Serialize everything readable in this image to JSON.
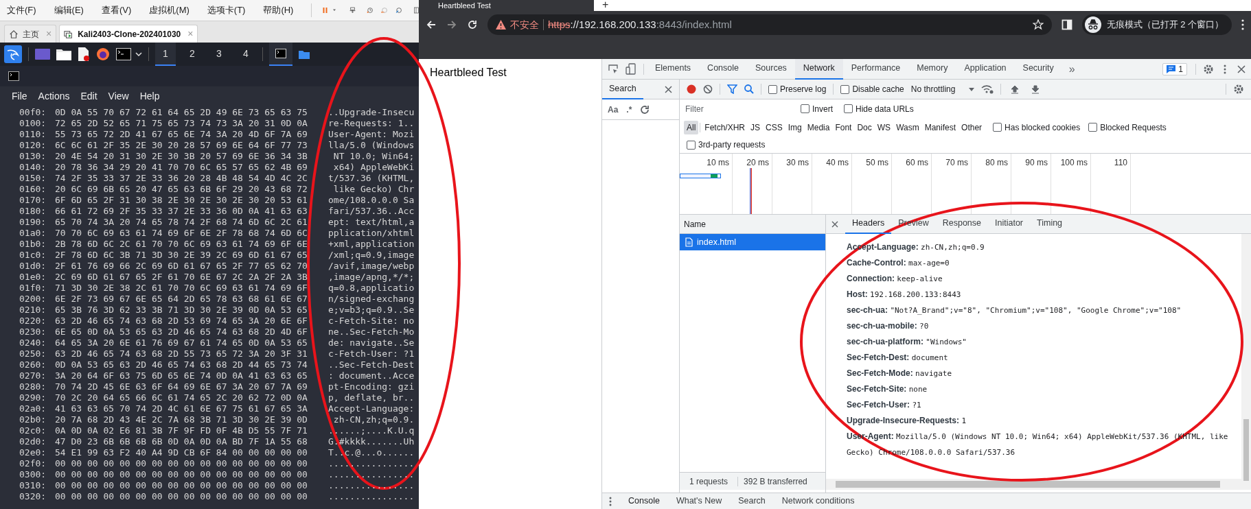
{
  "vm": {
    "menu": [
      "文件(F)",
      "编辑(E)",
      "查看(V)",
      "虚拟机(M)",
      "选项卡(T)",
      "帮助(H)"
    ],
    "tabs": [
      {
        "label": "主页",
        "selected": false,
        "close": "×"
      },
      {
        "label": "Kali2403-Clone-202401030",
        "selected": true,
        "close": "×"
      }
    ],
    "workspaces": [
      {
        "label": "1",
        "selected": true
      },
      {
        "label": "2",
        "selected": false
      },
      {
        "label": "3",
        "selected": false
      },
      {
        "label": "4",
        "selected": false
      }
    ],
    "terminal": {
      "menu": [
        "File",
        "Actions",
        "Edit",
        "View",
        "Help"
      ],
      "hex_lines": [
        {
          "offset": "00f0:",
          "bytes": "0D 0A 55 70 67 72 61 64 65 2D 49 6E 73 65 63 75",
          "ascii": "..Upgrade-Insecu"
        },
        {
          "offset": "0100:",
          "bytes": "72 65 2D 52 65 71 75 65 73 74 73 3A 20 31 0D 0A",
          "ascii": "re-Requests: 1.."
        },
        {
          "offset": "0110:",
          "bytes": "55 73 65 72 2D 41 67 65 6E 74 3A 20 4D 6F 7A 69",
          "ascii": "User-Agent: Mozi"
        },
        {
          "offset": "0120:",
          "bytes": "6C 6C 61 2F 35 2E 30 20 28 57 69 6E 64 6F 77 73",
          "ascii": "lla/5.0 (Windows"
        },
        {
          "offset": "0130:",
          "bytes": "20 4E 54 20 31 30 2E 30 3B 20 57 69 6E 36 34 3B",
          "ascii": " NT 10.0; Win64;"
        },
        {
          "offset": "0140:",
          "bytes": "20 78 36 34 29 20 41 70 70 6C 65 57 65 62 4B 69",
          "ascii": " x64) AppleWebKi"
        },
        {
          "offset": "0150:",
          "bytes": "74 2F 35 33 37 2E 33 36 20 28 4B 48 54 4D 4C 2C",
          "ascii": "t/537.36 (KHTML,"
        },
        {
          "offset": "0160:",
          "bytes": "20 6C 69 6B 65 20 47 65 63 6B 6F 29 20 43 68 72",
          "ascii": " like Gecko) Chr"
        },
        {
          "offset": "0170:",
          "bytes": "6F 6D 65 2F 31 30 38 2E 30 2E 30 2E 30 20 53 61",
          "ascii": "ome/108.0.0.0 Sa"
        },
        {
          "offset": "0180:",
          "bytes": "66 61 72 69 2F 35 33 37 2E 33 36 0D 0A 41 63 63",
          "ascii": "fari/537.36..Acc"
        },
        {
          "offset": "0190:",
          "bytes": "65 70 74 3A 20 74 65 78 74 2F 68 74 6D 6C 2C 61",
          "ascii": "ept: text/html,a"
        },
        {
          "offset": "01a0:",
          "bytes": "70 70 6C 69 63 61 74 69 6F 6E 2F 78 68 74 6D 6C",
          "ascii": "pplication/xhtml"
        },
        {
          "offset": "01b0:",
          "bytes": "2B 78 6D 6C 2C 61 70 70 6C 69 63 61 74 69 6F 6E",
          "ascii": "+xml,application"
        },
        {
          "offset": "01c0:",
          "bytes": "2F 78 6D 6C 3B 71 3D 30 2E 39 2C 69 6D 61 67 65",
          "ascii": "/xml;q=0.9,image"
        },
        {
          "offset": "01d0:",
          "bytes": "2F 61 76 69 66 2C 69 6D 61 67 65 2F 77 65 62 70",
          "ascii": "/avif,image/webp"
        },
        {
          "offset": "01e0:",
          "bytes": "2C 69 6D 61 67 65 2F 61 70 6E 67 2C 2A 2F 2A 3B",
          "ascii": ",image/apng,*/*;"
        },
        {
          "offset": "01f0:",
          "bytes": "71 3D 30 2E 38 2C 61 70 70 6C 69 63 61 74 69 6F",
          "ascii": "q=0.8,applicatio"
        },
        {
          "offset": "0200:",
          "bytes": "6E 2F 73 69 67 6E 65 64 2D 65 78 63 68 61 6E 67",
          "ascii": "n/signed-exchang"
        },
        {
          "offset": "0210:",
          "bytes": "65 3B 76 3D 62 33 3B 71 3D 30 2E 39 0D 0A 53 65",
          "ascii": "e;v=b3;q=0.9..Se"
        },
        {
          "offset": "0220:",
          "bytes": "63 2D 46 65 74 63 68 2D 53 69 74 65 3A 20 6E 6F",
          "ascii": "c-Fetch-Site: no"
        },
        {
          "offset": "0230:",
          "bytes": "6E 65 0D 0A 53 65 63 2D 46 65 74 63 68 2D 4D 6F",
          "ascii": "ne..Sec-Fetch-Mo"
        },
        {
          "offset": "0240:",
          "bytes": "64 65 3A 20 6E 61 76 69 67 61 74 65 0D 0A 53 65",
          "ascii": "de: navigate..Se"
        },
        {
          "offset": "0250:",
          "bytes": "63 2D 46 65 74 63 68 2D 55 73 65 72 3A 20 3F 31",
          "ascii": "c-Fetch-User: ?1"
        },
        {
          "offset": "0260:",
          "bytes": "0D 0A 53 65 63 2D 46 65 74 63 68 2D 44 65 73 74",
          "ascii": "..Sec-Fetch-Dest"
        },
        {
          "offset": "0270:",
          "bytes": "3A 20 64 6F 63 75 6D 65 6E 74 0D 0A 41 63 63 65",
          "ascii": ": document..Acce"
        },
        {
          "offset": "0280:",
          "bytes": "70 74 2D 45 6E 63 6F 64 69 6E 67 3A 20 67 7A 69",
          "ascii": "pt-Encoding: gzi"
        },
        {
          "offset": "0290:",
          "bytes": "70 2C 20 64 65 66 6C 61 74 65 2C 20 62 72 0D 0A",
          "ascii": "p, deflate, br.."
        },
        {
          "offset": "02a0:",
          "bytes": "41 63 63 65 70 74 2D 4C 61 6E 67 75 61 67 65 3A",
          "ascii": "Accept-Language:"
        },
        {
          "offset": "02b0:",
          "bytes": "20 7A 68 2D 43 4E 2C 7A 68 3B 71 3D 30 2E 39 0D",
          "ascii": " zh-CN,zh;q=0.9."
        },
        {
          "offset": "02c0:",
          "bytes": "0A 0D 0A 02 E6 81 3B 7F 9F FD 0F 4B D5 55 7F 71",
          "ascii": "......;....K.U.q"
        },
        {
          "offset": "02d0:",
          "bytes": "47 D0 23 6B 6B 6B 6B 0D 0A 0D 0A BD 7F 1A 55 68",
          "ascii": "G.#kkkk.......Uh"
        },
        {
          "offset": "02e0:",
          "bytes": "54 E1 99 63 F2 40 A4 9D CB 6F 84 00 00 00 00 00",
          "ascii": "T..c.@...o......"
        },
        {
          "offset": "02f0:",
          "bytes": "00 00 00 00 00 00 00 00 00 00 00 00 00 00 00 00",
          "ascii": "................"
        },
        {
          "offset": "0300:",
          "bytes": "00 00 00 00 00 00 00 00 00 00 00 00 00 00 00 00",
          "ascii": "................"
        },
        {
          "offset": "0310:",
          "bytes": "00 00 00 00 00 00 00 00 00 00 00 00 00 00 00 00",
          "ascii": "................"
        },
        {
          "offset": "0320:",
          "bytes": "00 00 00 00 00 00 00 00 00 00 00 00 00 00 00 00",
          "ascii": "................"
        }
      ]
    }
  },
  "browser": {
    "tab_title": "Heartbleed Test",
    "new_tab": "+",
    "security_label": "不安全",
    "url": {
      "scheme": "https",
      "host": "://192.168.200.133",
      "rest": ":8443/index.html"
    },
    "profile_label": "无痕模式（已打开 2 个窗口）",
    "page": {
      "heading": "Heartbleed Test"
    }
  },
  "devtools": {
    "tabs": [
      {
        "label": "Elements",
        "selected": false
      },
      {
        "label": "Console",
        "selected": false
      },
      {
        "label": "Sources",
        "selected": false
      },
      {
        "label": "Network",
        "selected": true
      },
      {
        "label": "Performance",
        "selected": false
      },
      {
        "label": "Memory",
        "selected": false
      },
      {
        "label": "Application",
        "selected": false
      },
      {
        "label": "Security",
        "selected": false
      }
    ],
    "more": "»",
    "issues_count": "1",
    "search_panel": {
      "tab": "Search",
      "options": [
        "Aa",
        ".*"
      ]
    },
    "network": {
      "toolbar_checkboxes": [
        {
          "label": "Preserve log",
          "checked": false
        },
        {
          "label": "Disable cache",
          "checked": false
        }
      ],
      "throttling": "No throttling",
      "filter_placeholder": "Filter",
      "filter_checkboxes": [
        {
          "label": "Invert",
          "checked": false
        },
        {
          "label": "Hide data URLs",
          "checked": false
        }
      ],
      "types": [
        {
          "label": "All",
          "selected": true
        },
        {
          "label": "Fetch/XHR",
          "selected": false
        },
        {
          "label": "JS",
          "selected": false
        },
        {
          "label": "CSS",
          "selected": false
        },
        {
          "label": "Img",
          "selected": false
        },
        {
          "label": "Media",
          "selected": false
        },
        {
          "label": "Font",
          "selected": false
        },
        {
          "label": "Doc",
          "selected": false
        },
        {
          "label": "WS",
          "selected": false
        },
        {
          "label": "Wasm",
          "selected": false
        },
        {
          "label": "Manifest",
          "selected": false
        },
        {
          "label": "Other",
          "selected": false
        }
      ],
      "type_checkboxes": [
        {
          "label": "Has blocked cookies",
          "checked": false
        },
        {
          "label": "Blocked Requests",
          "checked": false
        }
      ],
      "extra_checkboxes": [
        {
          "label": "3rd-party requests",
          "checked": false
        }
      ],
      "timeline_ticks": [
        "10 ms",
        "20 ms",
        "30 ms",
        "40 ms",
        "50 ms",
        "60 ms",
        "70 ms",
        "80 ms",
        "90 ms",
        "100 ms",
        "110"
      ],
      "name_column": "Name",
      "requests": [
        {
          "name": "index.html",
          "selected": true
        }
      ],
      "detail_tabs": [
        {
          "label": "Headers",
          "selected": true
        },
        {
          "label": "Preview",
          "selected": false
        },
        {
          "label": "Response",
          "selected": false
        },
        {
          "label": "Initiator",
          "selected": false
        },
        {
          "label": "Timing",
          "selected": false
        }
      ],
      "headers": [
        {
          "name": "Accept-Language:",
          "value": "zh-CN,zh;q=0.9"
        },
        {
          "name": "Cache-Control:",
          "value": "max-age=0"
        },
        {
          "name": "Connection:",
          "value": "keep-alive"
        },
        {
          "name": "Host:",
          "value": "192.168.200.133:8443"
        },
        {
          "name": "sec-ch-ua:",
          "value": "\"Not?A_Brand\";v=\"8\", \"Chromium\";v=\"108\", \"Google Chrome\";v=\"108\""
        },
        {
          "name": "sec-ch-ua-mobile:",
          "value": "?0"
        },
        {
          "name": "sec-ch-ua-platform:",
          "value": "\"Windows\""
        },
        {
          "name": "Sec-Fetch-Dest:",
          "value": "document"
        },
        {
          "name": "Sec-Fetch-Mode:",
          "value": "navigate"
        },
        {
          "name": "Sec-Fetch-Site:",
          "value": "none"
        },
        {
          "name": "Sec-Fetch-User:",
          "value": "?1"
        },
        {
          "name": "Upgrade-Insecure-Requests:",
          "value": "1"
        },
        {
          "name": "User-Agent:",
          "value": "Mozilla/5.0 (Windows NT 10.0; Win64; x64) AppleWebKit/537.36 (KHTML, like Gecko) Chrome/108.0.0.0 Safari/537.36"
        }
      ],
      "requests_count": "1 requests",
      "transferred": "392 B transferred"
    },
    "drawer_tabs": [
      "Console",
      "What's New",
      "Search",
      "Network conditions"
    ]
  },
  "annotations": [
    {
      "kind": "ellipse"
    },
    {
      "kind": "ellipse"
    }
  ]
}
